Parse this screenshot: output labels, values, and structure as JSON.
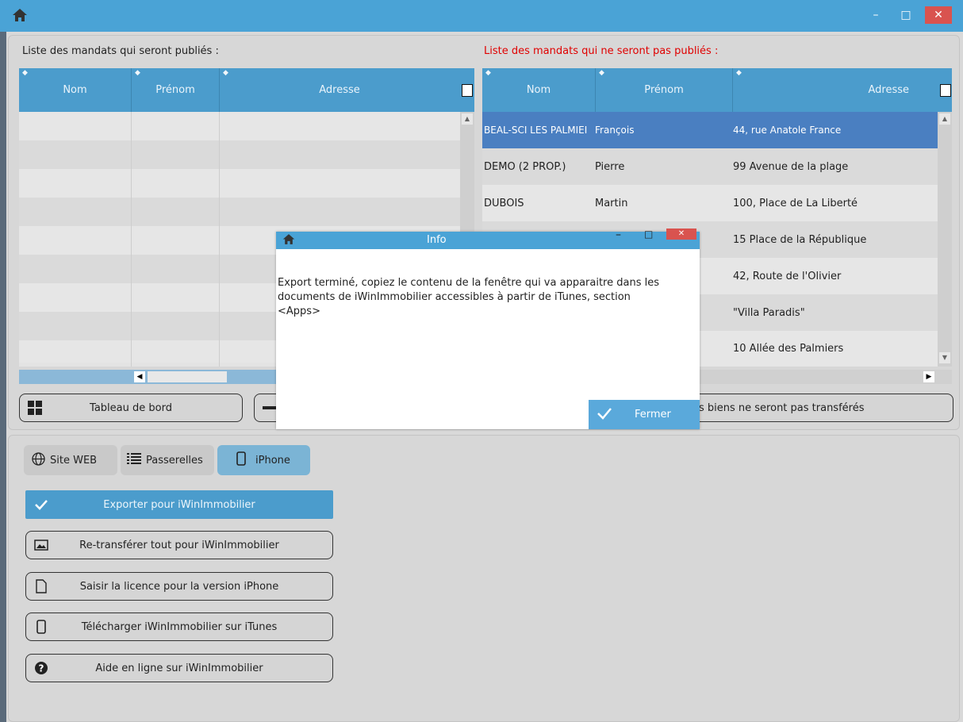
{
  "window": {
    "minimize": "–",
    "maximize": "□",
    "close": "✕"
  },
  "published": {
    "label": "Liste des mandats qui seront publiés :",
    "columns": [
      "Nom",
      "Prénom",
      "Adresse"
    ]
  },
  "unpublished": {
    "label": "Liste des mandats qui ne seront pas publiés :",
    "columns": [
      "Nom",
      "Prénom",
      "Adresse"
    ],
    "rows": [
      {
        "nom": "BEAL-SCI LES PALMIEI",
        "prenom": "François",
        "adresse": "44, rue Anatole France"
      },
      {
        "nom": "DEMO (2 PROP.)",
        "prenom": "Pierre",
        "adresse": "99 Avenue de la plage"
      },
      {
        "nom": "DUBOIS",
        "prenom": "Martin",
        "adresse": "100, Place de La Liberté"
      },
      {
        "nom": "",
        "prenom": "",
        "adresse": "15 Place de la République"
      },
      {
        "nom": "",
        "prenom": "",
        "adresse": "42, Route de l'Olivier"
      },
      {
        "nom": "",
        "prenom": "",
        "adresse": "\"Villa Paradis\""
      },
      {
        "nom": "",
        "prenom": "",
        "adresse": "10 Allée des Palmiers"
      }
    ]
  },
  "buttons": {
    "dashboard": "Tableau de bord",
    "not_transferred": "s biens ne seront pas transférés"
  },
  "tabs": [
    {
      "label": "Site WEB"
    },
    {
      "label": "Passerelles"
    },
    {
      "label": "iPhone"
    }
  ],
  "actions": [
    {
      "label": "Exporter pour iWinImmobilier"
    },
    {
      "label": "Re-transférer tout pour iWinImmobilier"
    },
    {
      "label": "Saisir la licence pour la version iPhone"
    },
    {
      "label": "Télécharger iWinImmobilier sur iTunes"
    },
    {
      "label": "Aide en ligne sur iWinImmobilier"
    }
  ],
  "dialog": {
    "title": "Info",
    "message": "Export terminé, copiez le contenu de la fenêtre qui va apparaitre dans les documents de iWinImmobilier accessibles à partir de iTunes, section <Apps>",
    "close_label": "Fermer"
  },
  "colors": {
    "accent": "#4aa3d6",
    "header": "#4b9ccc",
    "selected_row": "#4a7fc1",
    "warning_text": "#e00000"
  }
}
